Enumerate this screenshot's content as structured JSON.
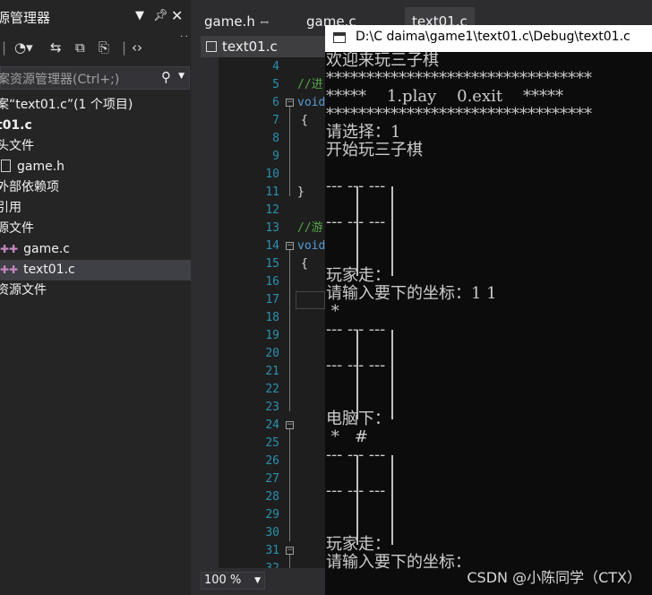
{
  "solution_explorer": {
    "title": "源管理器",
    "search_placeholder": "案资源管理器(Ctrl+;)",
    "tree": [
      {
        "label": "案“text01.c”(1 个项目)",
        "bold": false
      },
      {
        "label": "t01.c",
        "bold": true
      },
      {
        "label": "头文件",
        "bold": false
      },
      {
        "label": "game.h",
        "bold": false
      },
      {
        "label": "外部依赖项",
        "bold": false
      },
      {
        "label": "引用",
        "bold": false
      },
      {
        "label": "源文件",
        "bold": false
      },
      {
        "label": "game.c",
        "bold": false
      },
      {
        "label": "text01.c",
        "bold": false
      },
      {
        "label": "资源文件",
        "bold": false
      }
    ]
  },
  "tabs": {
    "game_h": "game.h",
    "game_c": "game.c",
    "text01_c": "text01.c",
    "doc_tab": "text01.c"
  },
  "editor": {
    "line_numbers": [
      "4",
      "5",
      "6",
      "7",
      "8",
      "9",
      "10",
      "11",
      "12",
      "13",
      "14",
      "15",
      "16",
      "17",
      "18",
      "19",
      "20",
      "21",
      "22",
      "23",
      "24",
      "25",
      "26",
      "27",
      "28",
      "29",
      "30",
      "31",
      "32"
    ],
    "code": {
      "l5": "//进",
      "l6": "void",
      "l7": "{",
      "l11": "}",
      "l13": "//游",
      "l14": "void",
      "l15": "{"
    },
    "zoom": "100 %"
  },
  "console": {
    "title": "D:\\C   daima\\game1\\text01.c\\Debug\\text01.c",
    "lines": [
      "欢迎来玩三子棋",
      "*********************************",
      "*****    1.play    0.exit    *****",
      "*********************************",
      "请选择：1",
      "开始玩三子棋",
      "",
      "--- --- ---",
      "",
      "--- --- ---",
      "",
      "",
      "玩家走：",
      "请输入要下的坐标：1 1",
      " *",
      "--- --- ---",
      "",
      "--- --- ---",
      "",
      "",
      "电脑下：",
      " *   #",
      "--- --- ---",
      "",
      "--- --- ---",
      "",
      "",
      "玩家走：",
      "请输入要下的坐标："
    ],
    "watermark": "CSDN @小陈同学（CTX）"
  }
}
